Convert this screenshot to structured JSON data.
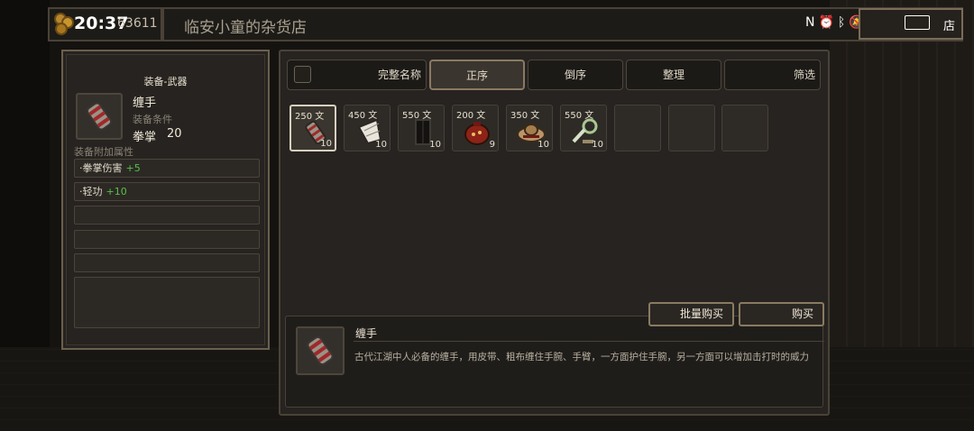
{
  "status_bar": {
    "time": "20:37",
    "money": "63611",
    "shop_title": "临安小童的杂货店",
    "close_shop_label": "店"
  },
  "equip_panel": {
    "title": "装备-武器",
    "item_name": "缠手",
    "requirement_label": "装备条件",
    "requirement_skill": "拳掌",
    "requirement_value": "20",
    "bonus_title": "装备附加属性",
    "attributes": [
      {
        "name": "·拳掌伤害",
        "value": "+5"
      },
      {
        "name": "·轻功",
        "value": "+10"
      }
    ]
  },
  "shop_panel": {
    "tabs": {
      "full_name": "完整名称",
      "ascending": "正序",
      "descending": "倒序",
      "arrange": "整理",
      "filter": "筛选"
    },
    "items": [
      {
        "price": "250 文",
        "qty": "10",
        "icon": "wrist-wrap-icon",
        "selected": true
      },
      {
        "price": "450 文",
        "qty": "10",
        "icon": "fan-icon"
      },
      {
        "price": "550 文",
        "qty": "10",
        "icon": "black-armor-icon"
      },
      {
        "price": "200 文",
        "qty": "9",
        "icon": "red-pouch-icon"
      },
      {
        "price": "350 文",
        "qty": "10",
        "icon": "bamboo-hat-icon"
      },
      {
        "price": "550 文",
        "qty": "10",
        "icon": "green-whip-icon"
      }
    ],
    "bulk_buy_label": "批量购买",
    "buy_label": "购买"
  },
  "description": {
    "title": "缠手",
    "text": "古代江湖中人必备的缠手，用皮带、粗布缠住手腕、手臂，一方面护住手腕，另一方面可以增加击打时的威力"
  },
  "colors": {
    "panel_bg": "#262320",
    "border": "#6b5f4e",
    "bonus_green": "#58c048",
    "text_light": "#f0e8d8"
  }
}
